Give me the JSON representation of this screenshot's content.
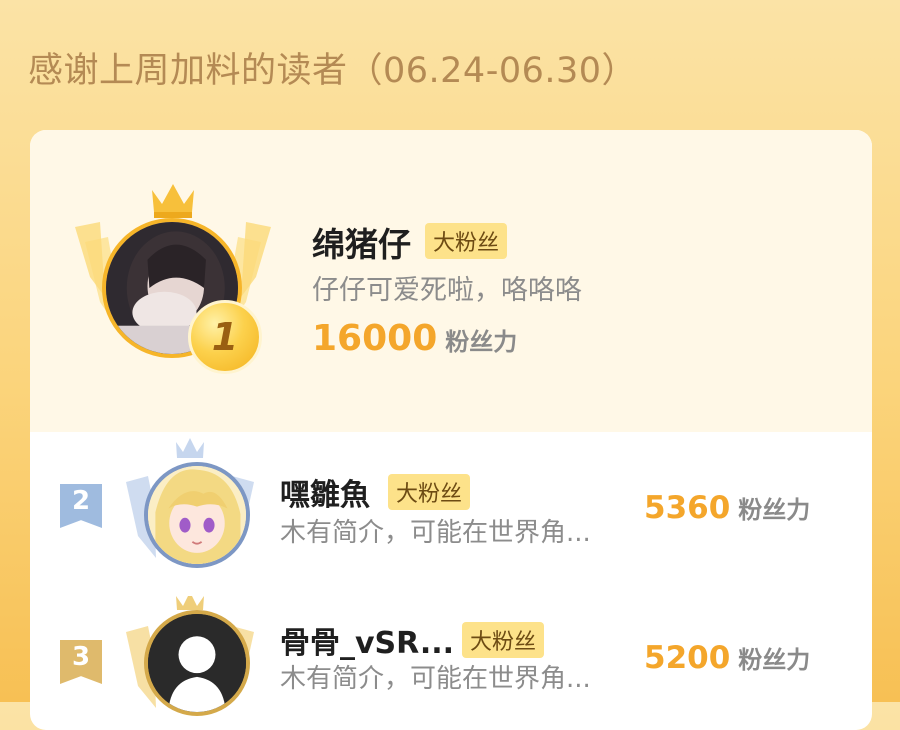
{
  "header": {
    "title": "感谢上周加料的读者（06.24-06.30）"
  },
  "ranking": [
    {
      "rank": "1",
      "name": "绵猪仔",
      "badge": "大粉丝",
      "bio": "仔仔可爱死啦，咯咯咯",
      "power": "16000",
      "power_unit": "粉丝力"
    },
    {
      "rank": "2",
      "name": "嘿雛魚",
      "badge": "大粉丝",
      "bio": "木有简介，可能在世界角...",
      "power": "5360",
      "power_unit": "粉丝力"
    },
    {
      "rank": "3",
      "name": "骨骨_vSR...",
      "badge": "大粉丝",
      "bio": "木有简介，可能在世界角...",
      "power": "5200",
      "power_unit": "粉丝力"
    }
  ],
  "icons": {
    "crown": "crown-icon",
    "wings": "wings-icon",
    "medal": "gold-medal-icon"
  },
  "colors": {
    "accent": "#f4a62b",
    "badge_bg": "#fde28a",
    "rank2": "#9fbbdf",
    "rank3": "#dfba6c"
  }
}
